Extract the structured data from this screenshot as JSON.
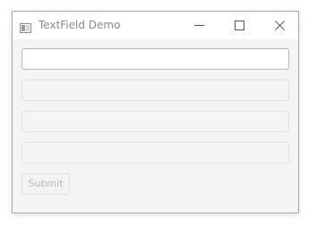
{
  "window": {
    "title": "TextField Demo",
    "app_icon": "window-app-icon",
    "controls": {
      "minimize_icon": "minimize-icon",
      "maximize_icon": "maximize-icon",
      "close_icon": "close-icon"
    }
  },
  "form": {
    "fields": [
      {
        "value": "",
        "placeholder": ""
      },
      {
        "value": "",
        "placeholder": ""
      },
      {
        "value": "",
        "placeholder": ""
      },
      {
        "value": "",
        "placeholder": ""
      }
    ],
    "submit_label": "Submit"
  },
  "colors": {
    "window_background": "#f4f4f4",
    "titlebar_background": "#ffffff",
    "title_text": "#8a8a8a",
    "disabled_text": "#b7b7b7"
  }
}
